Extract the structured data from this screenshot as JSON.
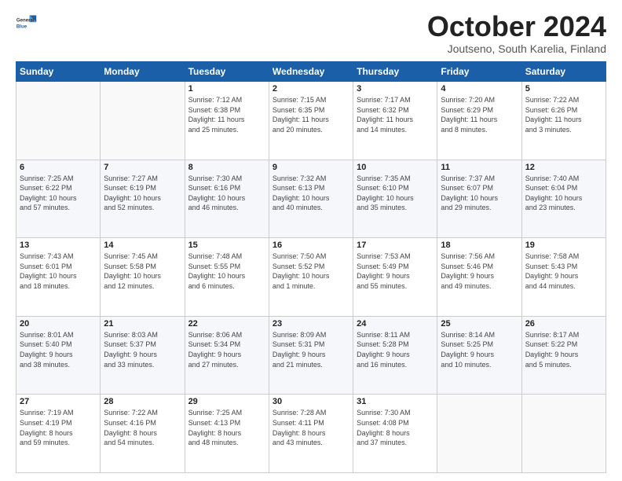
{
  "logo": {
    "general": "General",
    "blue": "Blue"
  },
  "header": {
    "month": "October 2024",
    "location": "Joutseno, South Karelia, Finland"
  },
  "days_of_week": [
    "Sunday",
    "Monday",
    "Tuesday",
    "Wednesday",
    "Thursday",
    "Friday",
    "Saturday"
  ],
  "weeks": [
    [
      {
        "day": "",
        "info": ""
      },
      {
        "day": "",
        "info": ""
      },
      {
        "day": "1",
        "info": "Sunrise: 7:12 AM\nSunset: 6:38 PM\nDaylight: 11 hours\nand 25 minutes."
      },
      {
        "day": "2",
        "info": "Sunrise: 7:15 AM\nSunset: 6:35 PM\nDaylight: 11 hours\nand 20 minutes."
      },
      {
        "day": "3",
        "info": "Sunrise: 7:17 AM\nSunset: 6:32 PM\nDaylight: 11 hours\nand 14 minutes."
      },
      {
        "day": "4",
        "info": "Sunrise: 7:20 AM\nSunset: 6:29 PM\nDaylight: 11 hours\nand 8 minutes."
      },
      {
        "day": "5",
        "info": "Sunrise: 7:22 AM\nSunset: 6:26 PM\nDaylight: 11 hours\nand 3 minutes."
      }
    ],
    [
      {
        "day": "6",
        "info": "Sunrise: 7:25 AM\nSunset: 6:22 PM\nDaylight: 10 hours\nand 57 minutes."
      },
      {
        "day": "7",
        "info": "Sunrise: 7:27 AM\nSunset: 6:19 PM\nDaylight: 10 hours\nand 52 minutes."
      },
      {
        "day": "8",
        "info": "Sunrise: 7:30 AM\nSunset: 6:16 PM\nDaylight: 10 hours\nand 46 minutes."
      },
      {
        "day": "9",
        "info": "Sunrise: 7:32 AM\nSunset: 6:13 PM\nDaylight: 10 hours\nand 40 minutes."
      },
      {
        "day": "10",
        "info": "Sunrise: 7:35 AM\nSunset: 6:10 PM\nDaylight: 10 hours\nand 35 minutes."
      },
      {
        "day": "11",
        "info": "Sunrise: 7:37 AM\nSunset: 6:07 PM\nDaylight: 10 hours\nand 29 minutes."
      },
      {
        "day": "12",
        "info": "Sunrise: 7:40 AM\nSunset: 6:04 PM\nDaylight: 10 hours\nand 23 minutes."
      }
    ],
    [
      {
        "day": "13",
        "info": "Sunrise: 7:43 AM\nSunset: 6:01 PM\nDaylight: 10 hours\nand 18 minutes."
      },
      {
        "day": "14",
        "info": "Sunrise: 7:45 AM\nSunset: 5:58 PM\nDaylight: 10 hours\nand 12 minutes."
      },
      {
        "day": "15",
        "info": "Sunrise: 7:48 AM\nSunset: 5:55 PM\nDaylight: 10 hours\nand 6 minutes."
      },
      {
        "day": "16",
        "info": "Sunrise: 7:50 AM\nSunset: 5:52 PM\nDaylight: 10 hours\nand 1 minute."
      },
      {
        "day": "17",
        "info": "Sunrise: 7:53 AM\nSunset: 5:49 PM\nDaylight: 9 hours\nand 55 minutes."
      },
      {
        "day": "18",
        "info": "Sunrise: 7:56 AM\nSunset: 5:46 PM\nDaylight: 9 hours\nand 49 minutes."
      },
      {
        "day": "19",
        "info": "Sunrise: 7:58 AM\nSunset: 5:43 PM\nDaylight: 9 hours\nand 44 minutes."
      }
    ],
    [
      {
        "day": "20",
        "info": "Sunrise: 8:01 AM\nSunset: 5:40 PM\nDaylight: 9 hours\nand 38 minutes."
      },
      {
        "day": "21",
        "info": "Sunrise: 8:03 AM\nSunset: 5:37 PM\nDaylight: 9 hours\nand 33 minutes."
      },
      {
        "day": "22",
        "info": "Sunrise: 8:06 AM\nSunset: 5:34 PM\nDaylight: 9 hours\nand 27 minutes."
      },
      {
        "day": "23",
        "info": "Sunrise: 8:09 AM\nSunset: 5:31 PM\nDaylight: 9 hours\nand 21 minutes."
      },
      {
        "day": "24",
        "info": "Sunrise: 8:11 AM\nSunset: 5:28 PM\nDaylight: 9 hours\nand 16 minutes."
      },
      {
        "day": "25",
        "info": "Sunrise: 8:14 AM\nSunset: 5:25 PM\nDaylight: 9 hours\nand 10 minutes."
      },
      {
        "day": "26",
        "info": "Sunrise: 8:17 AM\nSunset: 5:22 PM\nDaylight: 9 hours\nand 5 minutes."
      }
    ],
    [
      {
        "day": "27",
        "info": "Sunrise: 7:19 AM\nSunset: 4:19 PM\nDaylight: 8 hours\nand 59 minutes."
      },
      {
        "day": "28",
        "info": "Sunrise: 7:22 AM\nSunset: 4:16 PM\nDaylight: 8 hours\nand 54 minutes."
      },
      {
        "day": "29",
        "info": "Sunrise: 7:25 AM\nSunset: 4:13 PM\nDaylight: 8 hours\nand 48 minutes."
      },
      {
        "day": "30",
        "info": "Sunrise: 7:28 AM\nSunset: 4:11 PM\nDaylight: 8 hours\nand 43 minutes."
      },
      {
        "day": "31",
        "info": "Sunrise: 7:30 AM\nSunset: 4:08 PM\nDaylight: 8 hours\nand 37 minutes."
      },
      {
        "day": "",
        "info": ""
      },
      {
        "day": "",
        "info": ""
      }
    ]
  ]
}
